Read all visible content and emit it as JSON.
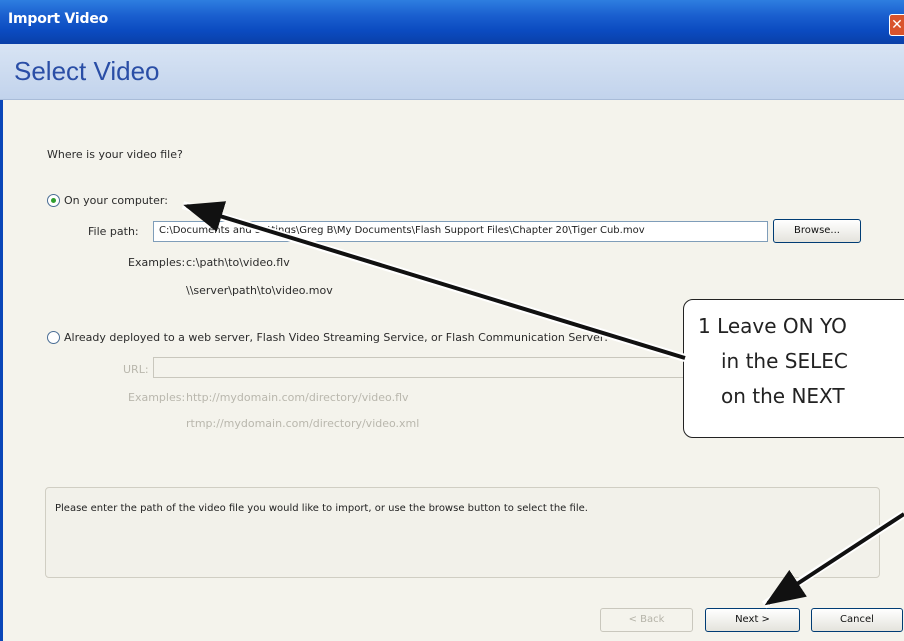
{
  "window": {
    "title": "Import Video",
    "close_glyph": "✕"
  },
  "header": {
    "title": "Select Video"
  },
  "main": {
    "question": "Where is your video file?",
    "option_computer": {
      "label": "On your computer:",
      "selected": true
    },
    "file_path": {
      "label": "File path:",
      "value": "C:\\Documents and Settings\\Greg B\\My Documents\\Flash Support Files\\Chapter 20\\Tiger Cub.mov",
      "browse_label": "Browse..."
    },
    "examples": {
      "label": "Examples:",
      "line1": "c:\\path\\to\\video.flv",
      "line2": "\\\\server\\path\\to\\video.mov"
    },
    "option_web": {
      "label": "Already deployed to a web server, Flash Video Streaming Service, or Flash Communication Server:",
      "selected": false
    },
    "url": {
      "label": "URL:",
      "value": ""
    },
    "url_examples": {
      "label": "Examples:",
      "line1": "http://mydomain.com/directory/video.flv",
      "line2": "rtmp://mydomain.com/directory/video.xml"
    },
    "info_text": "Please enter the path of the video file you would like to import, or use the browse button to select the file."
  },
  "footer": {
    "back_label": "< Back",
    "next_label": "Next >",
    "cancel_label": "Cancel"
  },
  "callout": {
    "line1": "1  Leave ON YO",
    "line2": "in the SELEC",
    "line3": "on the NEXT"
  },
  "colors": {
    "title_bar": "#0b4bc0",
    "header_text": "#2a4ea6",
    "close": "#d9532c"
  }
}
